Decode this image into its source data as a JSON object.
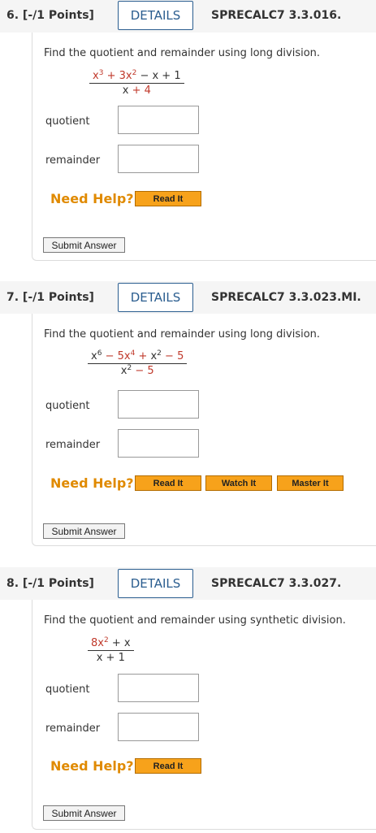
{
  "questions": [
    {
      "number": "6. [-/1 Points]",
      "details": "DETAILS",
      "code": "SPRECALC7 3.3.016.",
      "instruction": "Find the quotient and remainder using long division.",
      "quotient_label": "quotient",
      "remainder_label": "remainder",
      "need_help": "Need Help?",
      "help_buttons": [
        "Read It"
      ],
      "submit": "Submit Answer"
    },
    {
      "number": "7. [-/1 Points]",
      "details": "DETAILS",
      "code": "SPRECALC7 3.3.023.MI.",
      "instruction": "Find the quotient and remainder using long division.",
      "quotient_label": "quotient",
      "remainder_label": "remainder",
      "need_help": "Need Help?",
      "help_buttons": [
        "Read It",
        "Watch It",
        "Master It"
      ],
      "submit": "Submit Answer"
    },
    {
      "number": "8. [-/1 Points]",
      "details": "DETAILS",
      "code": "SPRECALC7 3.3.027.",
      "instruction": "Find the quotient and remainder using synthetic division.",
      "quotient_label": "quotient",
      "remainder_label": "remainder",
      "need_help": "Need Help?",
      "help_buttons": [
        "Read It"
      ],
      "submit": "Submit Answer"
    }
  ],
  "colors": {
    "details_border": "#2a5d8f",
    "need_help": "#e08a00",
    "help_button": "#f7a21b",
    "math_red": "#c0392b"
  }
}
